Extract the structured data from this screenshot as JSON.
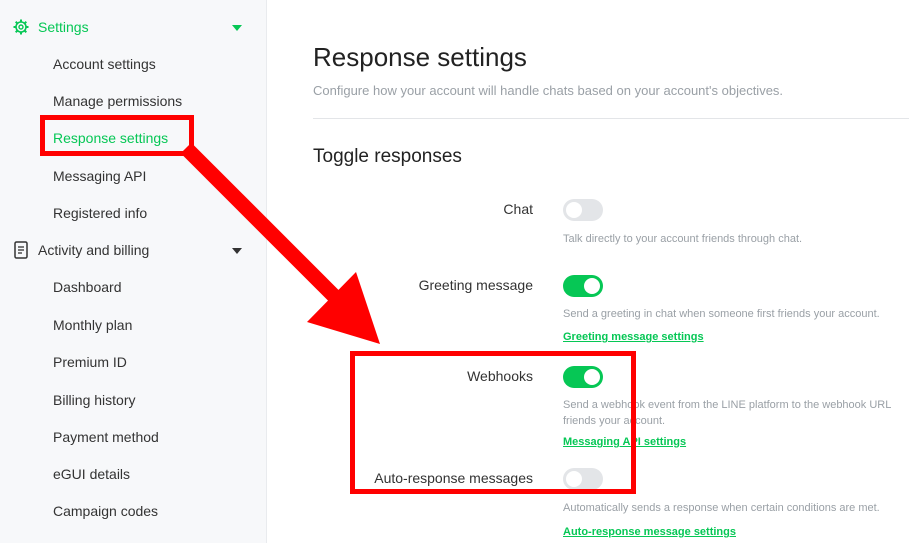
{
  "sidebar": {
    "settings_group": {
      "label": "Settings",
      "icon": "gear-icon"
    },
    "settings_items": [
      {
        "label": "Account settings"
      },
      {
        "label": "Manage permissions"
      },
      {
        "label": "Response settings"
      },
      {
        "label": "Messaging API"
      },
      {
        "label": "Registered info"
      }
    ],
    "billing_group": {
      "label": "Activity and billing",
      "icon": "document-icon"
    },
    "billing_items": [
      {
        "label": "Dashboard"
      },
      {
        "label": "Monthly plan"
      },
      {
        "label": "Premium ID"
      },
      {
        "label": "Billing history"
      },
      {
        "label": "Payment method"
      },
      {
        "label": "eGUI details"
      },
      {
        "label": "Campaign codes"
      }
    ]
  },
  "main": {
    "title": "Response settings",
    "subtitle": "Configure how your account will handle chats based on your account's objectives.",
    "section_title": "Toggle responses",
    "rows": [
      {
        "label": "Chat",
        "enabled": false,
        "description": "Talk directly to your account friends through chat."
      },
      {
        "label": "Greeting message",
        "enabled": true,
        "description": "Send a greeting in chat when someone first friends your account.",
        "link": "Greeting message settings"
      },
      {
        "label": "Webhooks",
        "enabled": true,
        "description_line1": "Send a webhook event from the LINE platform to the webhook URL",
        "description_line2": "friends your account.",
        "link": "Messaging API settings"
      },
      {
        "label": "Auto-response messages",
        "enabled": false,
        "description": "Automatically sends a response when certain conditions are met.",
        "link": "Auto-response message settings"
      }
    ]
  },
  "colors": {
    "accent": "#06c755",
    "annotation": "#ff0000",
    "toggle_off": "#e3e5e8"
  }
}
